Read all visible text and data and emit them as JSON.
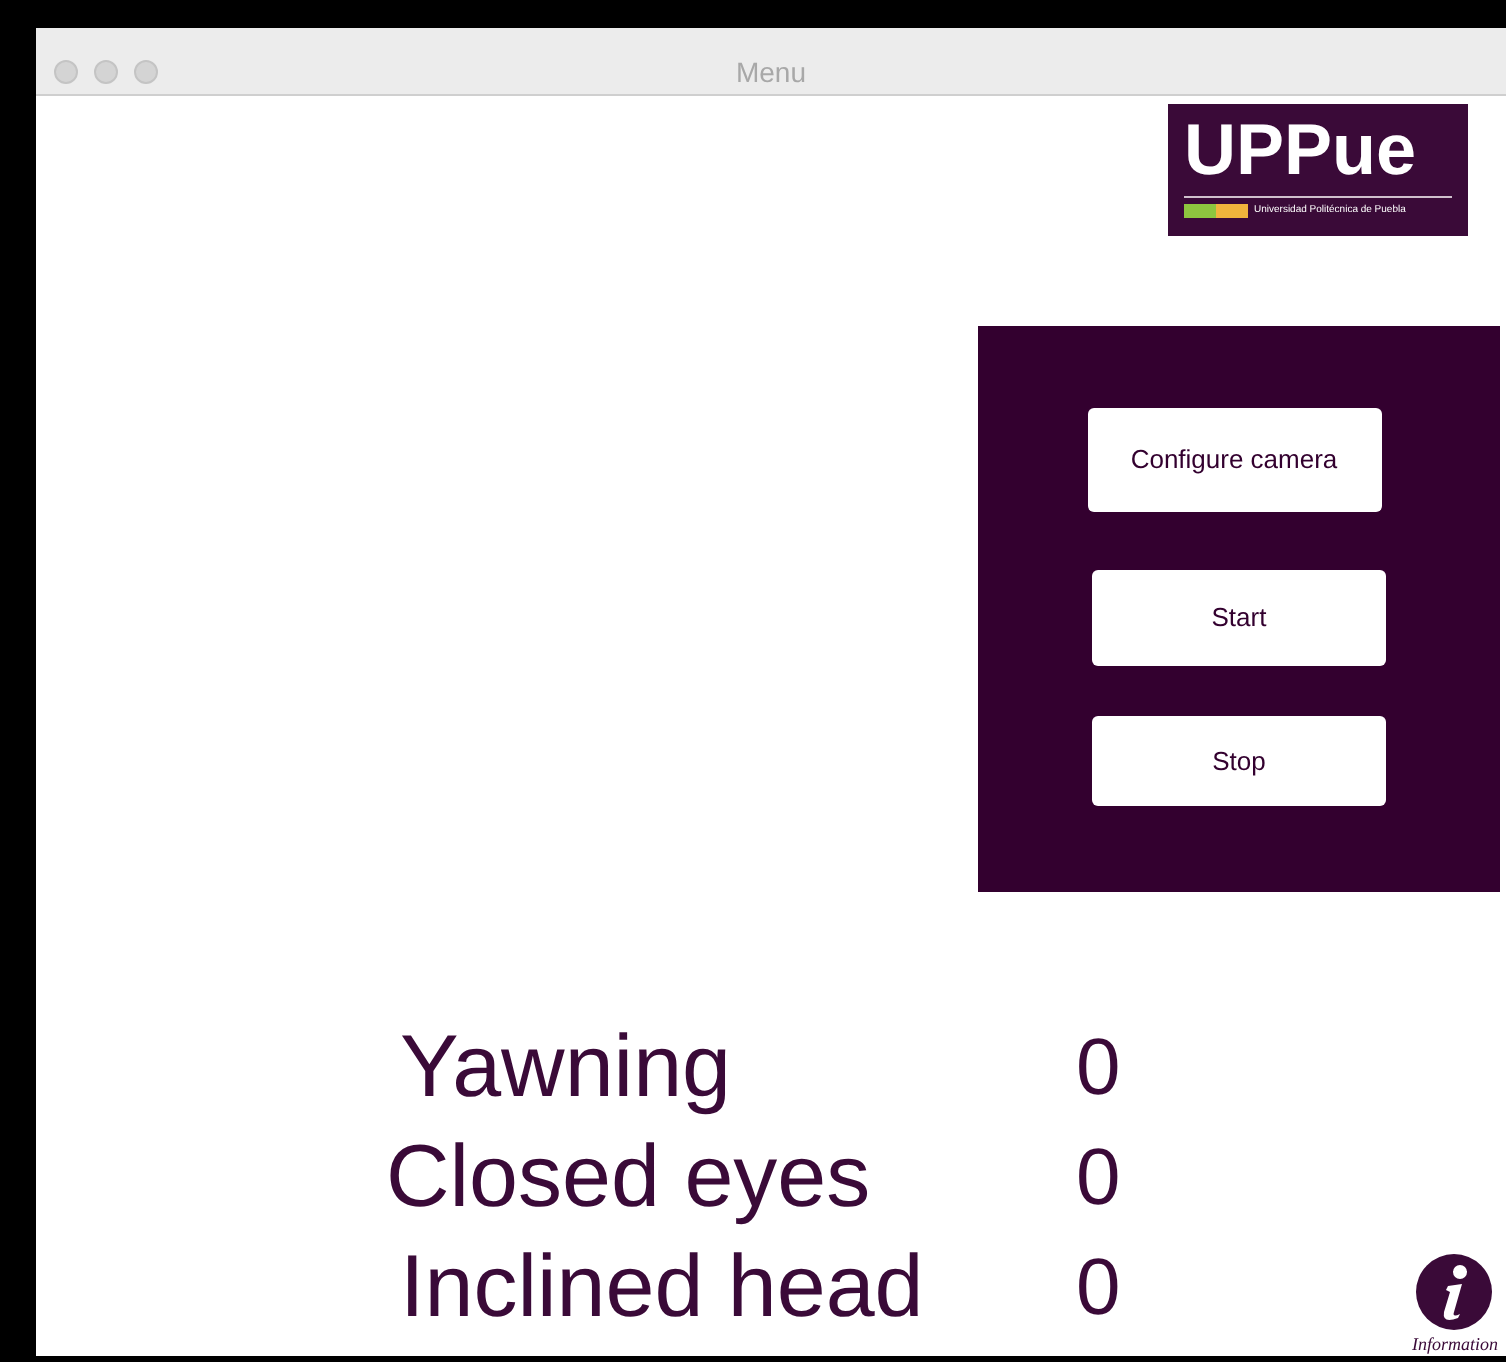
{
  "window": {
    "title": "Menu"
  },
  "logo": {
    "name": "UPPue",
    "subtitle": "Universidad Politécnica de Puebla"
  },
  "buttons": [
    "Configure camera",
    "Start",
    "Stop"
  ],
  "counters": [
    {
      "label": "Yawning",
      "value": "0"
    },
    {
      "label": "Closed eyes",
      "value": "0"
    },
    {
      "label": "Inclined head",
      "value": "0"
    }
  ],
  "info": {
    "label": "Information"
  }
}
